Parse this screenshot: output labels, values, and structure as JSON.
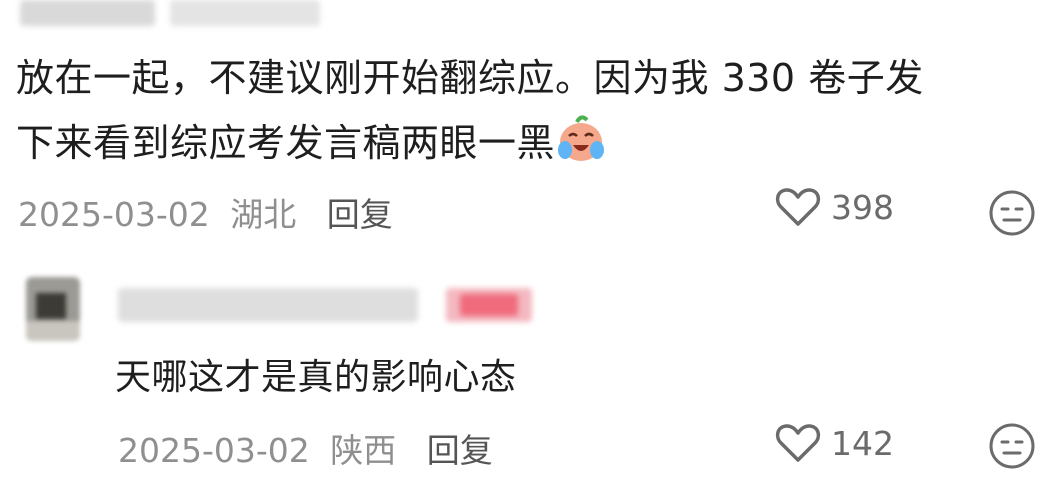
{
  "comment1": {
    "text_line1": "放在一起，不建议刚开始翻综应。因为我 330 卷子发",
    "text_line2": "下来看到综应考发言稿两眼一黑",
    "date": "2025-03-02",
    "location": "湖北",
    "reply_label": "回复",
    "likes": "398"
  },
  "comment2": {
    "text": "天哪这才是真的影响心态",
    "date": "2025-03-02",
    "location": "陕西",
    "reply_label": "回复",
    "likes": "142"
  },
  "icons": [
    "heart-outline-icon",
    "crying-emoji-icon",
    "meh-face-icon"
  ],
  "colors": {
    "meta_gray": "#8f8f8f",
    "author_tag_pink": "#f06b7c"
  }
}
